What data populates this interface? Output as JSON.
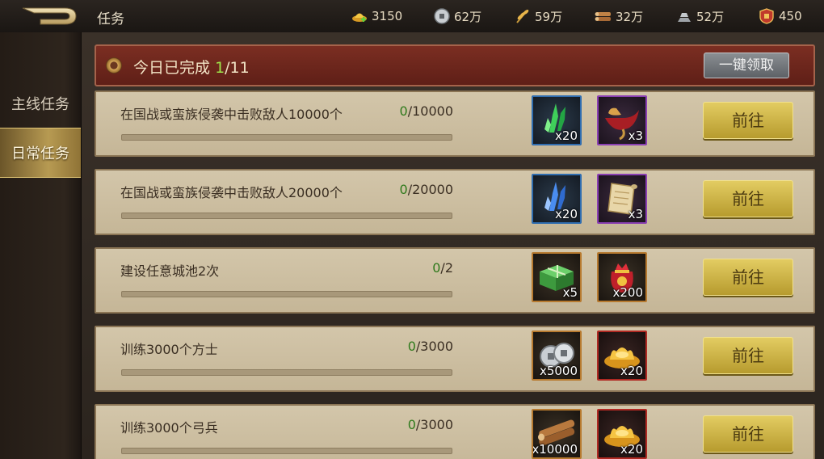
{
  "header": {
    "title": "任务",
    "resources": [
      {
        "icon": "gold-ingot-plus-icon",
        "value": "3150"
      },
      {
        "icon": "silver-coin-icon",
        "value": "62万"
      },
      {
        "icon": "wheat-icon",
        "value": "59万"
      },
      {
        "icon": "wood-logs-icon",
        "value": "32万"
      },
      {
        "icon": "iron-ingots-icon",
        "value": "52万"
      },
      {
        "icon": "seal-badge-icon",
        "value": "450"
      }
    ]
  },
  "sidebar": {
    "items": [
      {
        "label": "主线任务",
        "active": false
      },
      {
        "label": "日常任务",
        "active": true
      }
    ]
  },
  "summary": {
    "label": "今日已完成",
    "completed": "1",
    "total": "/11",
    "claim_all_label": "一键领取"
  },
  "tasks": [
    {
      "name": "在国战或蛮族侵袭中击败敌人10000个",
      "current": "0",
      "target": "/10000",
      "progress": 0,
      "rewards": [
        {
          "icon": "green-crystal-icon",
          "rarity": "blue",
          "qty": "x20"
        },
        {
          "icon": "red-saddle-icon",
          "rarity": "purple",
          "qty": "x3"
        }
      ],
      "go_label": "前往"
    },
    {
      "name": "在国战或蛮族侵袭中击败敌人20000个",
      "current": "0",
      "target": "/20000",
      "progress": 0,
      "rewards": [
        {
          "icon": "blue-crystal-icon",
          "rarity": "blue",
          "qty": "x20"
        },
        {
          "icon": "scroll-icon",
          "rarity": "purple",
          "qty": "x3"
        }
      ],
      "go_label": "前往"
    },
    {
      "name": "建设任意城池2次",
      "current": "0",
      "target": "/2",
      "progress": 0,
      "rewards": [
        {
          "icon": "green-gift-box-icon",
          "rarity": "orange",
          "qty": "x5"
        },
        {
          "icon": "red-lucky-bag-icon",
          "rarity": "orange",
          "qty": "x200"
        }
      ],
      "go_label": "前往"
    },
    {
      "name": "训练3000个方士",
      "current": "0",
      "target": "/3000",
      "progress": 0,
      "rewards": [
        {
          "icon": "silver-coins-icon",
          "rarity": "orange",
          "qty": "x5000"
        },
        {
          "icon": "gold-ingot-icon",
          "rarity": "red",
          "qty": "x20"
        }
      ],
      "go_label": "前往"
    },
    {
      "name": "训练3000个弓兵",
      "current": "0",
      "target": "/3000",
      "progress": 0,
      "rewards": [
        {
          "icon": "wood-logs-icon",
          "rarity": "orange",
          "qty": "x10000"
        },
        {
          "icon": "gold-ingot-icon",
          "rarity": "red",
          "qty": "x20"
        }
      ],
      "go_label": "前往"
    }
  ]
}
